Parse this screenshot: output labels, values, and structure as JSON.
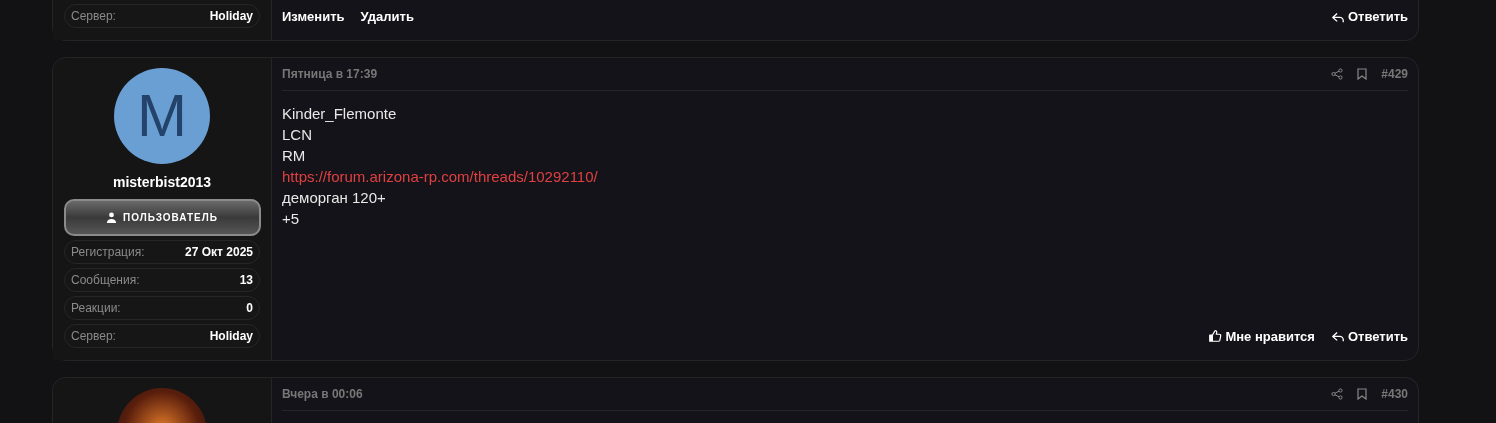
{
  "posts": [
    {
      "stats": [
        {
          "label": "Сервер:",
          "value": "Holiday"
        }
      ],
      "actions_left": [
        {
          "label": "Изменить"
        },
        {
          "label": "Удалить"
        }
      ],
      "actions": [
        {
          "kind": "reply",
          "label": "Ответить"
        }
      ]
    },
    {
      "avatar": {
        "kind": "letter",
        "letter": "M",
        "color": "#6a9fd4"
      },
      "author": "misterbist2013",
      "role": "ПОЛЬЗОВАТЕЛЬ",
      "stats": [
        {
          "label": "Регистрация:",
          "value": "27 Окт 2025"
        },
        {
          "label": "Сообщения:",
          "value": "13"
        },
        {
          "label": "Реакции:",
          "value": "0"
        },
        {
          "label": "Сервер:",
          "value": "Holiday"
        }
      ],
      "date": "Пятница в 17:39",
      "number": "#429",
      "body": [
        {
          "kind": "text",
          "text": "Kinder_Flemonte"
        },
        {
          "kind": "text",
          "text": "LCN"
        },
        {
          "kind": "text",
          "text": "RM"
        },
        {
          "kind": "link",
          "text": "https://forum.arizona-rp.com/threads/10292110/"
        },
        {
          "kind": "text",
          "text": "деморган 120+"
        },
        {
          "kind": "text",
          "text": "+5"
        }
      ],
      "actions": [
        {
          "kind": "like",
          "label": "Мне нравится"
        },
        {
          "kind": "reply",
          "label": "Ответить"
        }
      ]
    },
    {
      "avatar": {
        "kind": "photo"
      },
      "date": "Вчера в 00:06",
      "number": "#430"
    }
  ]
}
